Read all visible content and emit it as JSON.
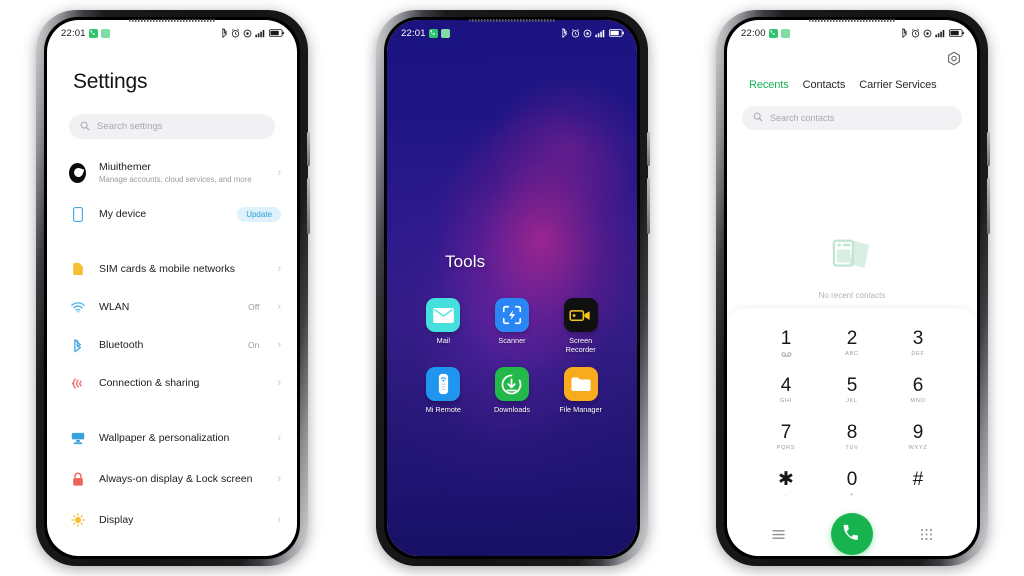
{
  "phones": [
    {
      "id": "settings-phone",
      "status_bar": {
        "time": "22:01",
        "notif_icons": [
          "phone-notification-icon",
          "sim-notification-icon"
        ],
        "right_icons": [
          "bluetooth-icon",
          "alarm-icon",
          "dnd-icon",
          "signal-icon",
          "battery-icon"
        ]
      },
      "title": "Settings",
      "search": {
        "placeholder": "Search settings",
        "icon": "search-icon"
      },
      "items": [
        {
          "label": "Miuithemer",
          "sub": "Manage accounts, cloud services, and more",
          "icon": "account-avatar",
          "chevron": "›"
        },
        {
          "label": "My device",
          "icon": "device-icon",
          "badge": "Update"
        },
        {
          "label": "SIM cards & mobile networks",
          "icon": "sim-card-icon",
          "chevron": "›"
        },
        {
          "label": "WLAN",
          "icon": "wifi-icon",
          "value": "Off",
          "chevron": "›"
        },
        {
          "label": "Bluetooth",
          "icon": "bluetooth-icon",
          "value": "On",
          "chevron": "›"
        },
        {
          "label": "Connection & sharing",
          "icon": "connection-sharing-icon",
          "chevron": "›"
        },
        {
          "label": "Wallpaper & personalization",
          "icon": "wallpaper-icon",
          "chevron": "›"
        },
        {
          "label": "Always-on display & Lock screen",
          "icon": "lock-icon",
          "chevron": "›"
        },
        {
          "label": "Display",
          "icon": "brightness-icon",
          "chevron": "›"
        }
      ]
    },
    {
      "id": "home-folder-phone",
      "status_bar": {
        "time": "22:01",
        "notif_icons": [
          "phone-notification-icon",
          "sim-notification-icon"
        ],
        "right_icons": [
          "bluetooth-icon",
          "alarm-icon",
          "dnd-icon",
          "signal-icon",
          "battery-icon"
        ]
      },
      "folder_title": "Tools",
      "wallpaper_colors": [
        "#1b1380",
        "#331d86",
        "#e92d8c",
        "#171063"
      ],
      "apps": [
        {
          "name": "Mail",
          "icon": "mail-icon",
          "bg": "#45e0dd"
        },
        {
          "name": "Scanner",
          "icon": "scanner-icon",
          "bg": "#2b86f5"
        },
        {
          "name": "Screen Recorder",
          "icon": "screen-recorder-icon",
          "bg": "#101010"
        },
        {
          "name": "Mi Remote",
          "icon": "mi-remote-icon",
          "bg": "#1f95f0"
        },
        {
          "name": "Downloads",
          "icon": "downloads-icon",
          "bg": "#23b84a"
        },
        {
          "name": "File Manager",
          "icon": "file-manager-icon",
          "bg": "#f8ab1c"
        }
      ]
    },
    {
      "id": "dialer-phone",
      "status_bar": {
        "time": "22:00",
        "notif_icons": [
          "phone-notification-icon",
          "sim-notification-icon"
        ],
        "right_icons": [
          "bluetooth-icon",
          "alarm-icon",
          "dnd-icon",
          "signal-icon",
          "battery-icon"
        ]
      },
      "settings_icon": "gear-icon",
      "tabs": [
        {
          "label": "Recents",
          "active": true
        },
        {
          "label": "Contacts",
          "active": false
        },
        {
          "label": "Carrier Services",
          "active": false
        }
      ],
      "accent_color": "#14b352",
      "search": {
        "placeholder": "Search contacts",
        "icon": "search-icon"
      },
      "empty_state": {
        "icon": "no-contacts-illustration",
        "text": "No recent contacts"
      },
      "keypad": [
        {
          "digit": "1",
          "sub": "",
          "vm": true
        },
        {
          "digit": "2",
          "sub": "ABC"
        },
        {
          "digit": "3",
          "sub": "DEF"
        },
        {
          "digit": "4",
          "sub": "GHI"
        },
        {
          "digit": "5",
          "sub": "JKL"
        },
        {
          "digit": "6",
          "sub": "MNO"
        },
        {
          "digit": "7",
          "sub": "PQRS"
        },
        {
          "digit": "8",
          "sub": "TUV"
        },
        {
          "digit": "9",
          "sub": "WXYZ"
        },
        {
          "digit": "✱",
          "sub": ","
        },
        {
          "digit": "0",
          "sub": "+"
        },
        {
          "digit": "#",
          "sub": ""
        }
      ],
      "actions": {
        "left_icon": "menu-lines-icon",
        "call_icon": "phone-call-icon",
        "right_icon": "keypad-grid-icon"
      }
    }
  ]
}
